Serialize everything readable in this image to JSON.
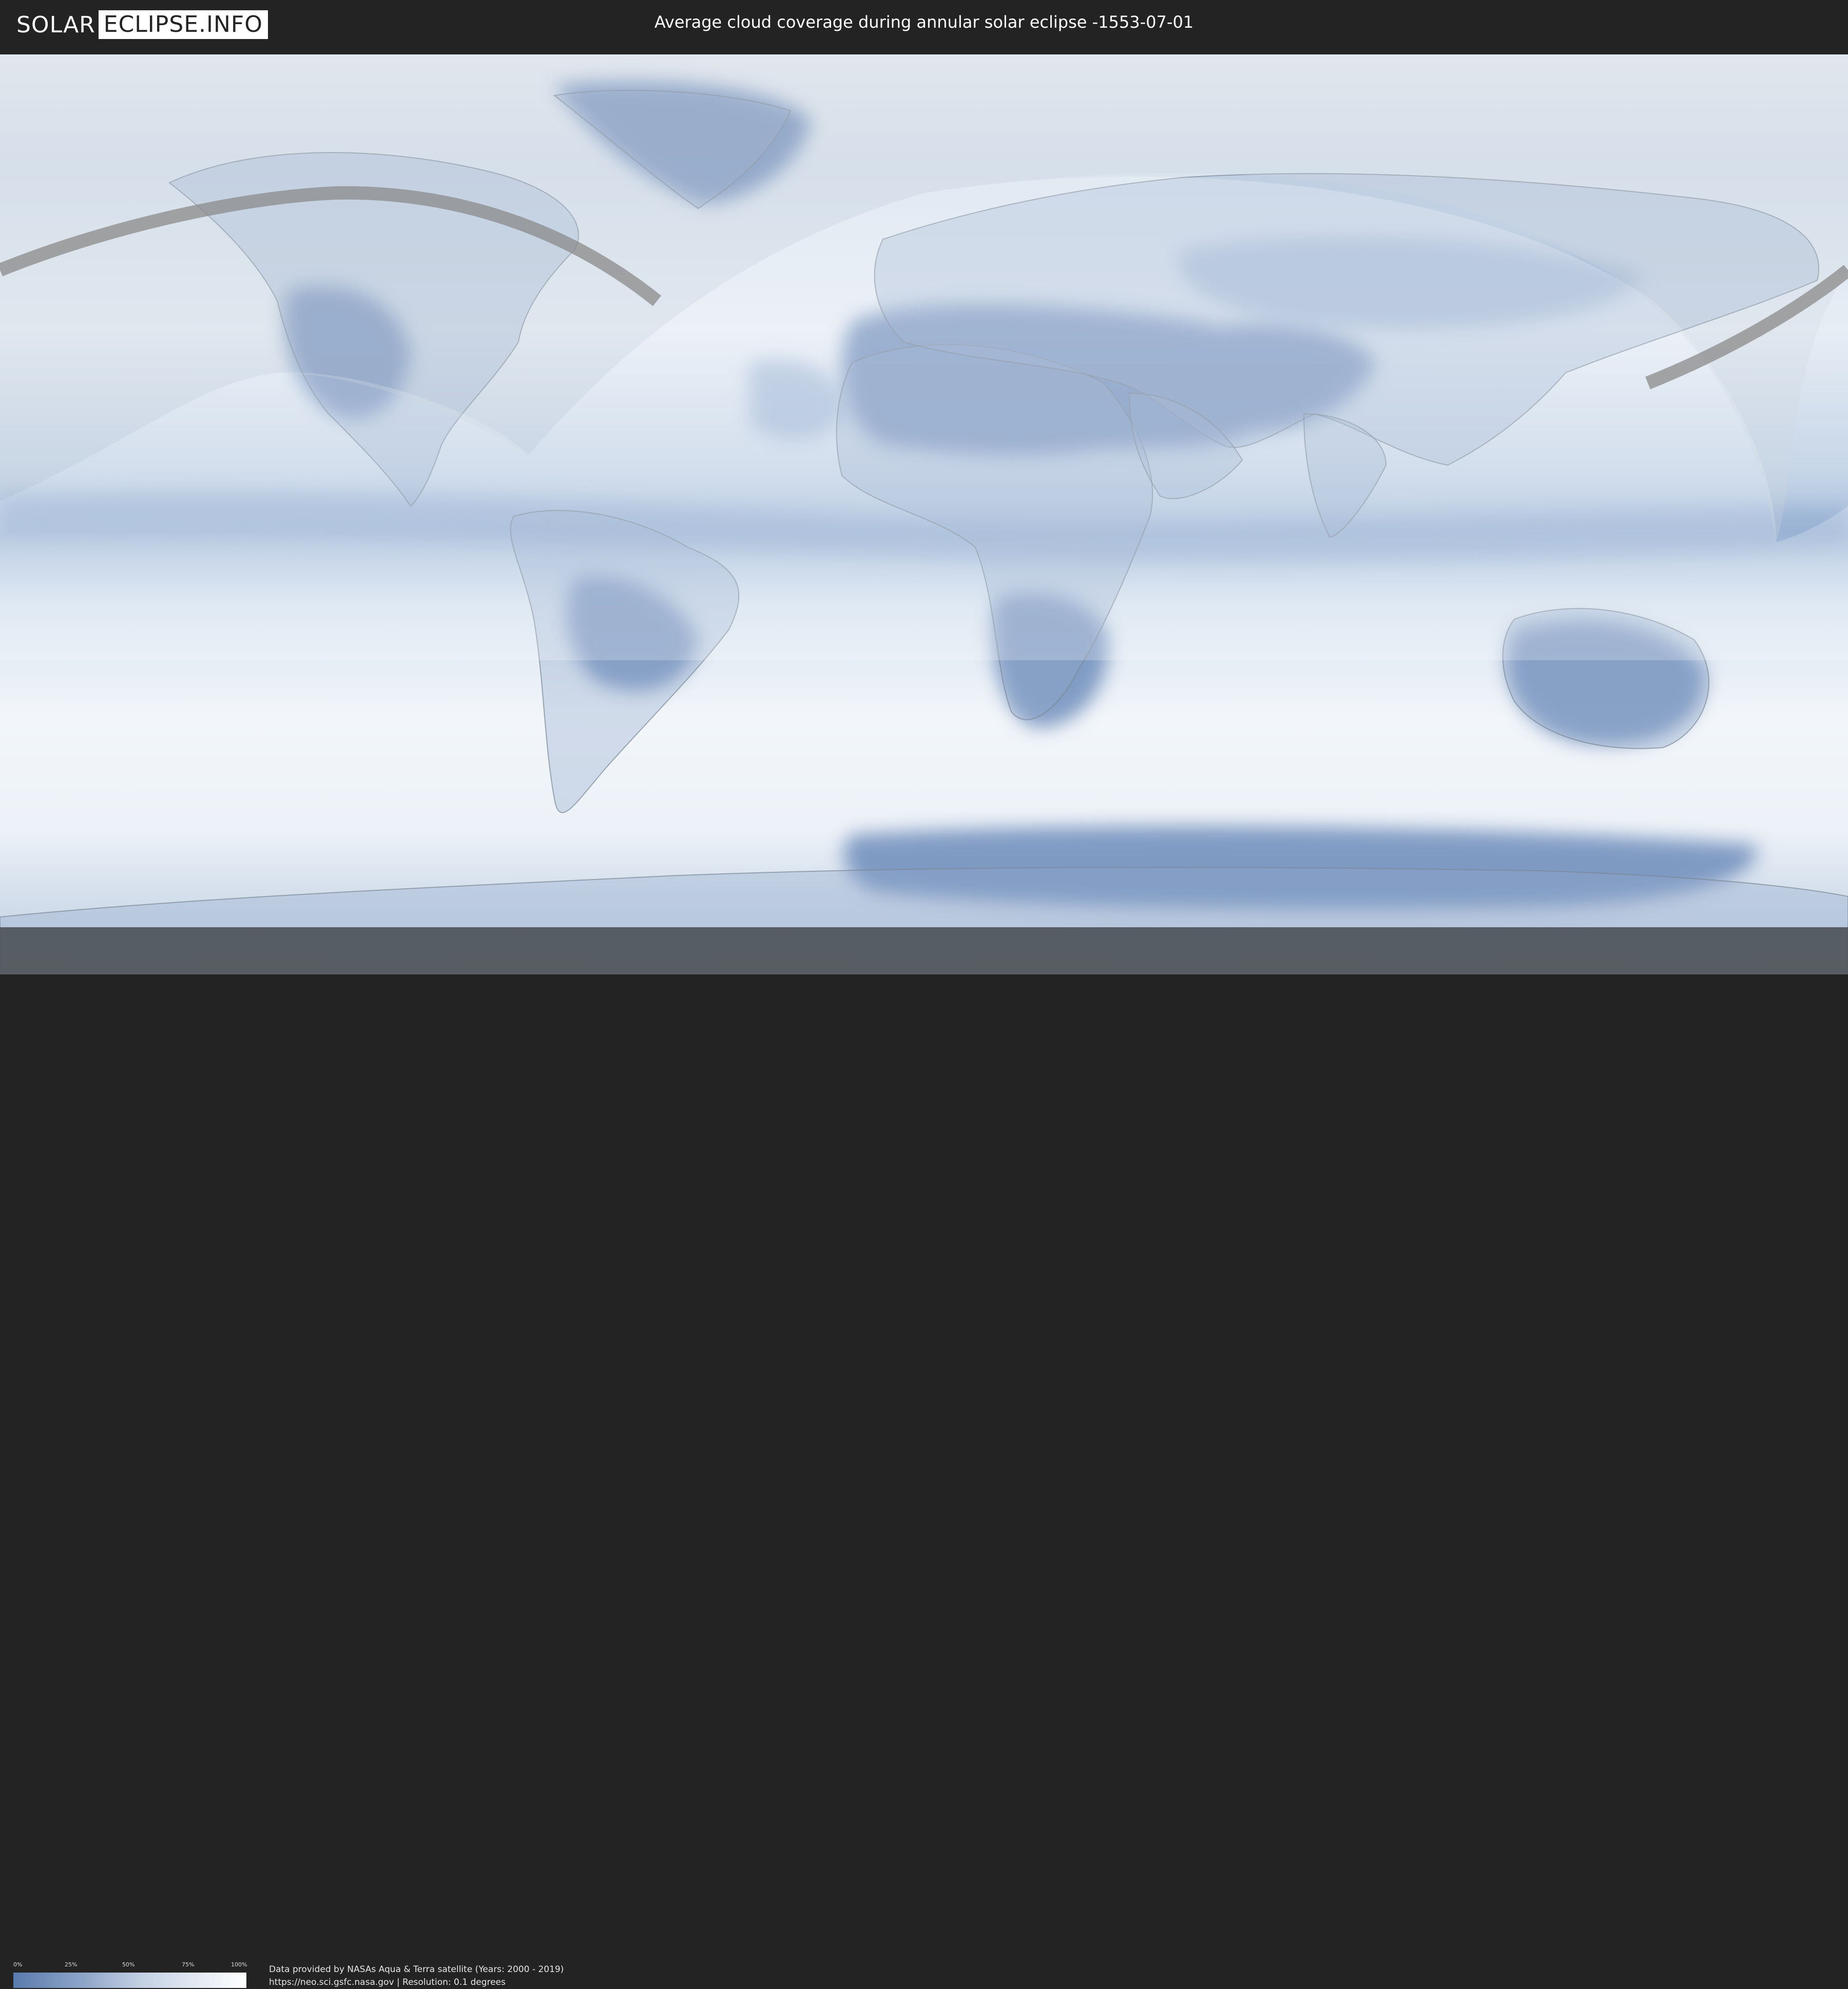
{
  "header": {
    "logo_left": "SOLAR",
    "logo_right": "ECLIPSE.INFO",
    "title": "Average cloud coverage during annular solar eclipse -1553-07-01"
  },
  "map": {
    "projection": "equirectangular world map",
    "layer": "average cloud coverage",
    "eclipse_path_color": "#8a8a8a",
    "visibility_region_tint": "#ffffff"
  },
  "legend": {
    "ticks": [
      "0%",
      "25%",
      "50%",
      "75%",
      "100%"
    ],
    "colors": {
      "low": "#5a7bad",
      "high": "#ffffff"
    }
  },
  "footer": {
    "credit_line1": "Data provided by NASAs Aqua & Terra satellite (Years: 2000 - 2019)",
    "credit_line2": "https://neo.sci.gsfc.nasa.gov | Resolution: 0.1 degrees"
  }
}
